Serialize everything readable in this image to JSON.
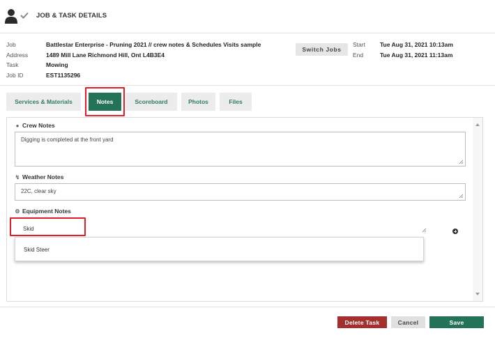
{
  "header": {
    "title": "JOB & TASK DETAILS",
    "user_icon": "user-icon",
    "check_icon": "checkmark-icon"
  },
  "info": {
    "job_label": "Job",
    "job_value": "Battlestar Enterprise - Pruning 2021 // crew notes & Schedules Visits sample",
    "address_label": "Address",
    "address_value": "1489 Mill Lane Richmond Hill, Ont L4B3E4",
    "task_label": "Task",
    "task_value": "Mowing",
    "jobid_label": "Job ID",
    "jobid_value": "EST1135296",
    "switch_label": "Switch Jobs",
    "start_label": "Start",
    "start_value": "Tue Aug 31, 2021 10:13am",
    "end_label": "End",
    "end_value": "Tue Aug 31, 2021 11:13am"
  },
  "tabs": [
    {
      "label": "Services & Materials"
    },
    {
      "label": "Notes",
      "active": true
    },
    {
      "label": "Scoreboard"
    },
    {
      "label": "Photos"
    },
    {
      "label": "Files"
    }
  ],
  "notes": {
    "crew_title": "Crew Notes",
    "crew_icon": "chat-bubble-icon",
    "crew_value": "Digging is completed at the front yard",
    "weather_title": "Weather Notes",
    "weather_icon": "lightning-icon",
    "weather_value": "22C, clear sky",
    "equipment_title": "Equipment Notes",
    "equipment_icon": "tractor-icon",
    "equipment_value": "Skid",
    "suggestion": "Skid Steer"
  },
  "footer": {
    "delete_label": "Delete Task",
    "cancel_label": "Cancel",
    "save_label": "Save"
  },
  "colors": {
    "accent": "#247359",
    "danger": "#a32f2f",
    "highlight": "#e41e26"
  }
}
